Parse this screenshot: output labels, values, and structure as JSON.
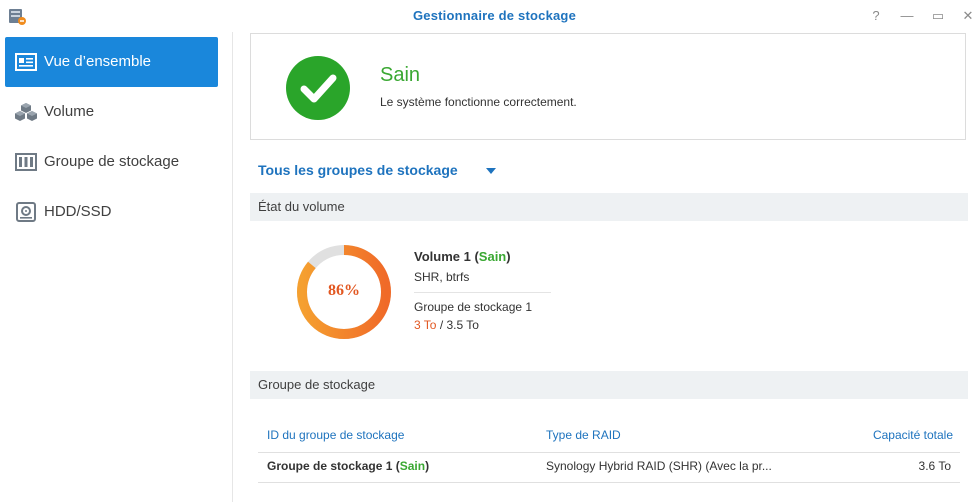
{
  "window": {
    "title": "Gestionnaire de stockage",
    "buttons": {
      "help": "?",
      "minimize": "—",
      "maximize": "▭",
      "close": "✕"
    }
  },
  "sidebar": {
    "items": [
      {
        "label": "Vue d’ensemble",
        "icon": "overview-icon",
        "active": true
      },
      {
        "label": "Volume",
        "icon": "cubes-icon",
        "active": false
      },
      {
        "label": "Groupe de stockage",
        "icon": "storage-pool-icon",
        "active": false
      },
      {
        "label": "HDD/SSD",
        "icon": "hdd-icon",
        "active": false
      }
    ]
  },
  "status": {
    "title": "Sain",
    "description": "Le système fonctionne correctement.",
    "icon": "check-icon"
  },
  "filter": {
    "selected": "Tous les groupes de stockage"
  },
  "volume_section": {
    "header": "État du volume",
    "usage_percent": 86,
    "usage_label": "86%",
    "volume_name": "Volume 1",
    "volume_status": "Sain",
    "volume_type": "SHR, btrfs",
    "pool_name": "Groupe de stockage 1",
    "used": "3 To",
    "separator": "/",
    "total": "3.5 To"
  },
  "pool_section": {
    "header": "Groupe de stockage",
    "columns": [
      "ID du groupe de stockage",
      "Type de RAID",
      "Capacité totale"
    ],
    "rows": [
      {
        "id": "Groupe de stockage 1",
        "status": "Sain",
        "raid": "Synology Hybrid RAID (SHR) (Avec la pr...",
        "capacity": "3.6 To"
      }
    ]
  },
  "colors": {
    "accent": "#1e73be",
    "active_nav": "#1a87db",
    "healthy": "#3aa832",
    "usage": "#e25822",
    "donut_start": "#f5a030",
    "donut_end": "#f06a28",
    "donut_track": "#e0e0e0"
  }
}
